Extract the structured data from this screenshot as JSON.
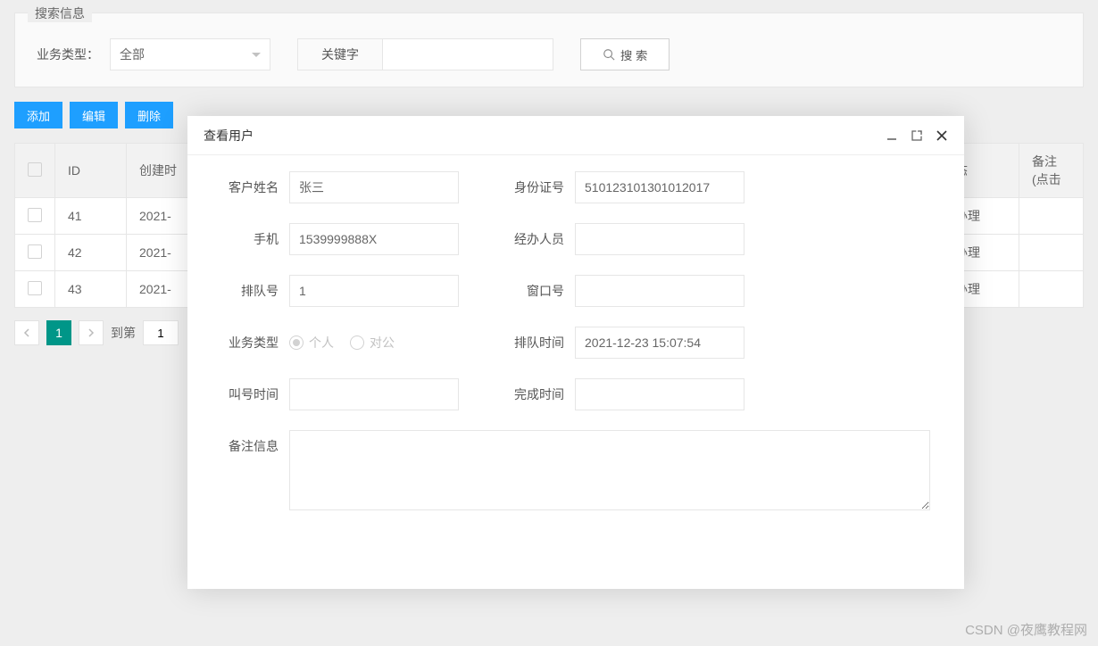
{
  "search": {
    "panel_label": "搜索信息",
    "type_label": "业务类型：",
    "type_value": "全部",
    "keyword_label": "关键字",
    "keyword_value": "",
    "button": "搜 索"
  },
  "toolbar": {
    "add": "添加",
    "edit": "编辑",
    "delete": "删除"
  },
  "table": {
    "headers": {
      "id": "ID",
      "created": "创建时",
      "status": "状态",
      "remark": "备注(点击"
    },
    "rows": [
      {
        "id": "41",
        "created": "2021-",
        "status": "待办理"
      },
      {
        "id": "42",
        "created": "2021-",
        "status": "待办理"
      },
      {
        "id": "43",
        "created": "2021-",
        "status": "待办理"
      }
    ]
  },
  "pager": {
    "page": "1",
    "goto_label": "到第",
    "goto_value": "1"
  },
  "modal": {
    "title": "查看用户",
    "fields": {
      "name_label": "客户姓名",
      "name_value": "张三",
      "idcard_label": "身份证号",
      "idcard_value": "510123101301012017",
      "phone_label": "手机",
      "phone_value": "1539999888X",
      "agent_label": "经办人员",
      "agent_value": "",
      "queue_label": "排队号",
      "queue_value": "1",
      "window_label": "窗口号",
      "window_value": "",
      "biztype_label": "业务类型",
      "biztype_personal": "个人",
      "biztype_corp": "对公",
      "queuetime_label": "排队时间",
      "queuetime_value": "2021-12-23 15:07:54",
      "calltime_label": "叫号时间",
      "calltime_value": "",
      "donetime_label": "完成时间",
      "donetime_value": "",
      "remark_label": "备注信息",
      "remark_value": ""
    }
  },
  "watermark": "CSDN @夜鹰教程网"
}
